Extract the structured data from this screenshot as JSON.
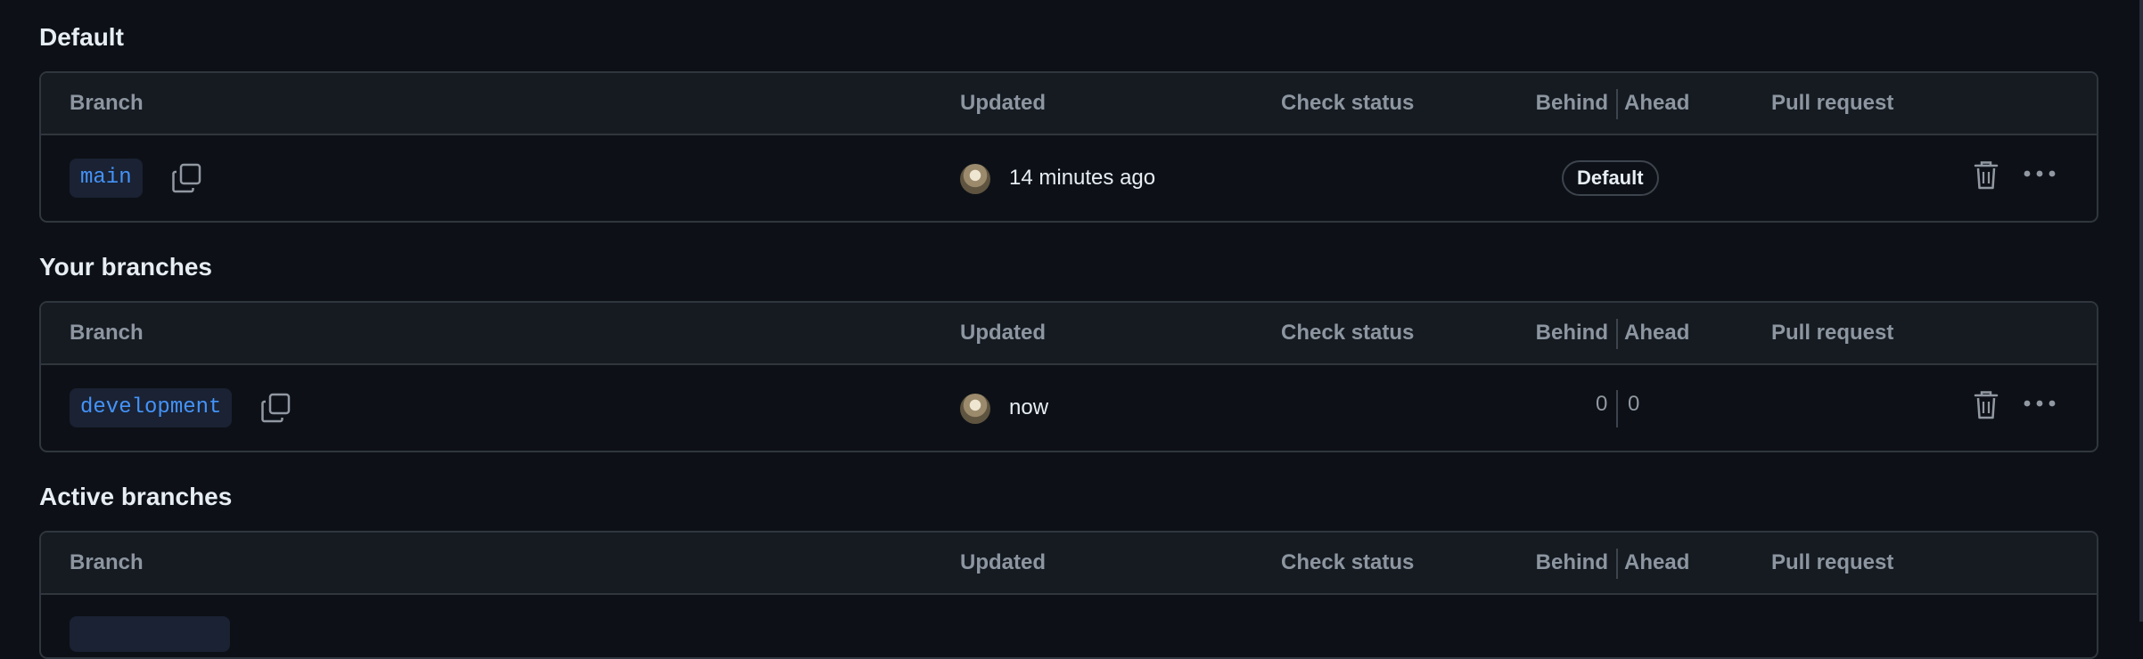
{
  "sections": [
    {
      "title": "Default",
      "headers": {
        "branch": "Branch",
        "updated": "Updated",
        "check": "Check status",
        "behind": "Behind",
        "ahead": "Ahead",
        "pr": "Pull request"
      },
      "row": {
        "branch": "main",
        "updated": "14 minutes ago",
        "badge": "Default"
      }
    },
    {
      "title": "Your branches",
      "headers": {
        "branch": "Branch",
        "updated": "Updated",
        "check": "Check status",
        "behind": "Behind",
        "ahead": "Ahead",
        "pr": "Pull request"
      },
      "row": {
        "branch": "development",
        "updated": "now",
        "behind": "0",
        "ahead": "0"
      }
    },
    {
      "title": "Active branches",
      "headers": {
        "branch": "Branch",
        "updated": "Updated",
        "check": "Check status",
        "behind": "Behind",
        "ahead": "Ahead",
        "pr": "Pull request"
      }
    }
  ],
  "icons": {
    "copy": "copy-icon",
    "trash": "trash-icon",
    "more": "kebab-horizontal-icon",
    "avatar": "user-avatar"
  },
  "colors": {
    "background": "#0d1117",
    "header_bg": "#161b22",
    "border": "#30363d",
    "branch_text": "#4493f8",
    "branch_bg": "#1a2233"
  }
}
